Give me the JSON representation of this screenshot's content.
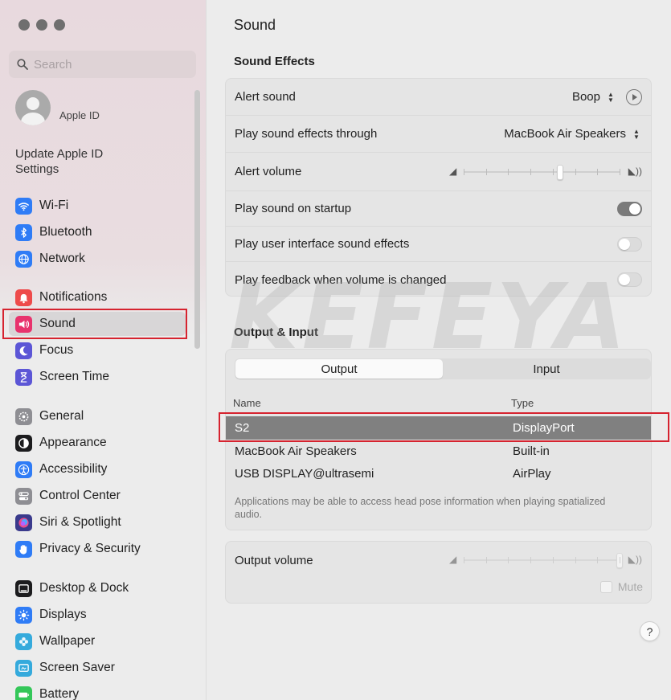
{
  "window": {
    "title": "Sound"
  },
  "sidebar": {
    "search_placeholder": "Search",
    "apple_id_label": "Apple ID",
    "update_text": "Update Apple ID Settings",
    "items": [
      {
        "label": "Wi-Fi",
        "icon": "wifi-icon",
        "color": "#2f7cf6"
      },
      {
        "label": "Bluetooth",
        "icon": "bluetooth-icon",
        "color": "#2f7cf6"
      },
      {
        "label": "Network",
        "icon": "globe-icon",
        "color": "#2f7cf6"
      },
      {
        "label": "Notifications",
        "icon": "bell-icon",
        "color": "#ee4b4b"
      },
      {
        "label": "Sound",
        "icon": "speaker-icon",
        "color": "#e8336d"
      },
      {
        "label": "Focus",
        "icon": "moon-icon",
        "color": "#5c56d6"
      },
      {
        "label": "Screen Time",
        "icon": "hourglass-icon",
        "color": "#5c56d6"
      },
      {
        "label": "General",
        "icon": "gear-icon",
        "color": "#8e8e93"
      },
      {
        "label": "Appearance",
        "icon": "appearance-icon",
        "color": "#1c1c1e"
      },
      {
        "label": "Accessibility",
        "icon": "accessibility-icon",
        "color": "#2f7cf6"
      },
      {
        "label": "Control Center",
        "icon": "switches-icon",
        "color": "#8e8e93"
      },
      {
        "label": "Siri & Spotlight",
        "icon": "siri-icon",
        "color": "#3a3a8c"
      },
      {
        "label": "Privacy & Security",
        "icon": "hand-icon",
        "color": "#2f7cf6"
      },
      {
        "label": "Desktop & Dock",
        "icon": "dock-icon",
        "color": "#1c1c1e"
      },
      {
        "label": "Displays",
        "icon": "sun-icon",
        "color": "#2f7cf6"
      },
      {
        "label": "Wallpaper",
        "icon": "flower-icon",
        "color": "#35aadc"
      },
      {
        "label": "Screen Saver",
        "icon": "screensaver-icon",
        "color": "#35aadc"
      },
      {
        "label": "Battery",
        "icon": "battery-icon",
        "color": "#34c759"
      }
    ],
    "active": "Sound"
  },
  "main": {
    "title": "Sound",
    "sound_effects": {
      "heading": "Sound Effects",
      "alert_sound_label": "Alert sound",
      "alert_sound_value": "Boop",
      "play_through_label": "Play sound effects through",
      "play_through_value": "MacBook Air Speakers",
      "alert_volume_label": "Alert volume",
      "alert_volume_level": 0.62,
      "startup_label": "Play sound on startup",
      "startup_on": true,
      "ui_effects_label": "Play user interface sound effects",
      "ui_effects_on": false,
      "feedback_label": "Play feedback when volume is changed",
      "feedback_on": false
    },
    "output_input": {
      "heading": "Output & Input",
      "tabs": [
        "Output",
        "Input"
      ],
      "active_tab": "Output",
      "columns": [
        "Name",
        "Type"
      ],
      "devices": [
        {
          "name": "S2",
          "type": "DisplayPort",
          "selected": true
        },
        {
          "name": "MacBook Air Speakers",
          "type": "Built-in",
          "selected": false
        },
        {
          "name": "USB DISPLAY@ultrasemi",
          "type": "AirPlay",
          "selected": false
        }
      ],
      "footnote": "Applications may be able to access head pose information when playing spatialized audio."
    },
    "output_volume": {
      "label": "Output volume",
      "level": 1.0,
      "mute_label": "Mute"
    },
    "help_label": "?"
  },
  "watermark": "KEFEYA",
  "colors": {
    "highlight_red": "#d6232f",
    "selected_row": "#808080"
  }
}
